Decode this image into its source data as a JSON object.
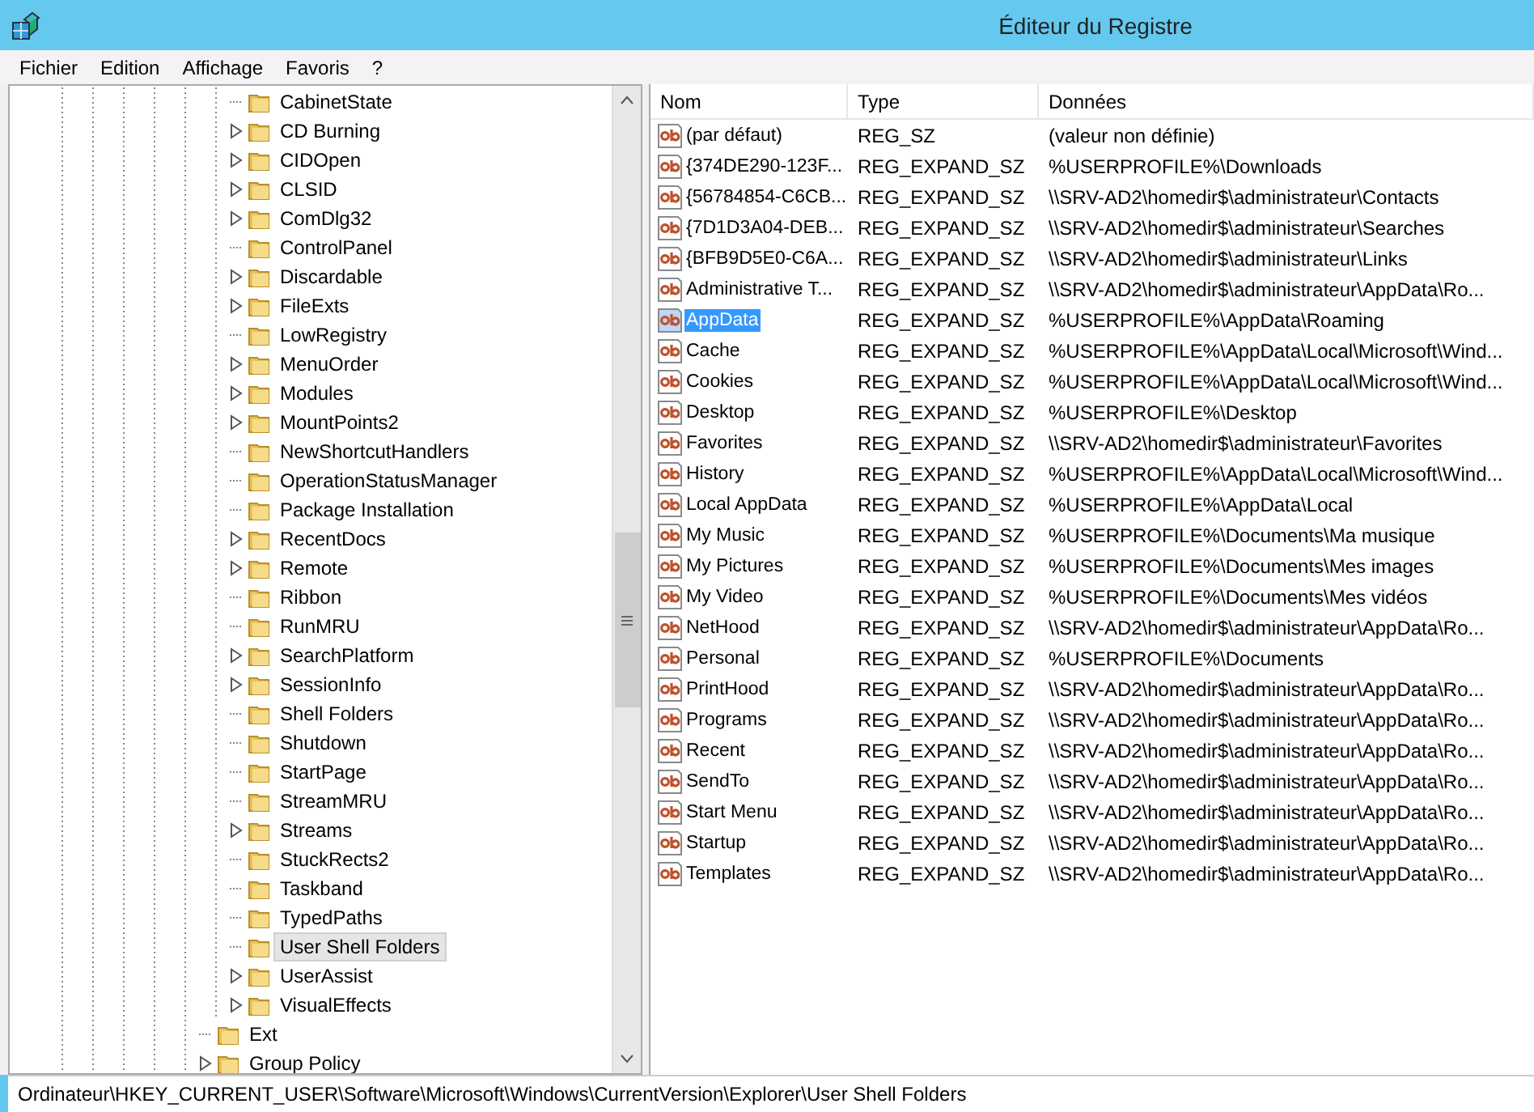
{
  "window": {
    "title": "Éditeur du Registre"
  },
  "menu": [
    "Fichier",
    "Edition",
    "Affichage",
    "Favoris",
    "?"
  ],
  "tree": {
    "nodes": [
      {
        "children": [
          {
            "label": "CabinetState",
            "expandable": false,
            "selected": false
          },
          {
            "label": "CD Burning",
            "expandable": true,
            "selected": false
          },
          {
            "label": "CIDOpen",
            "expandable": true,
            "selected": false
          },
          {
            "label": "CLSID",
            "expandable": true,
            "selected": false
          },
          {
            "label": "ComDlg32",
            "expandable": true,
            "selected": false
          },
          {
            "label": "ControlPanel",
            "expandable": false,
            "selected": false
          },
          {
            "label": "Discardable",
            "expandable": true,
            "selected": false
          },
          {
            "label": "FileExts",
            "expandable": true,
            "selected": false
          },
          {
            "label": "LowRegistry",
            "expandable": false,
            "selected": false
          },
          {
            "label": "MenuOrder",
            "expandable": true,
            "selected": false
          },
          {
            "label": "Modules",
            "expandable": true,
            "selected": false
          },
          {
            "label": "MountPoints2",
            "expandable": true,
            "selected": false
          },
          {
            "label": "NewShortcutHandlers",
            "expandable": false,
            "selected": false
          },
          {
            "label": "OperationStatusManager",
            "expandable": false,
            "selected": false
          },
          {
            "label": "Package Installation",
            "expandable": false,
            "selected": false
          },
          {
            "label": "RecentDocs",
            "expandable": true,
            "selected": false
          },
          {
            "label": "Remote",
            "expandable": true,
            "selected": false
          },
          {
            "label": "Ribbon",
            "expandable": false,
            "selected": false
          },
          {
            "label": "RunMRU",
            "expandable": false,
            "selected": false
          },
          {
            "label": "SearchPlatform",
            "expandable": true,
            "selected": false
          },
          {
            "label": "SessionInfo",
            "expandable": true,
            "selected": false
          },
          {
            "label": "Shell Folders",
            "expandable": false,
            "selected": false
          },
          {
            "label": "Shutdown",
            "expandable": false,
            "selected": false
          },
          {
            "label": "StartPage",
            "expandable": false,
            "selected": false
          },
          {
            "label": "StreamMRU",
            "expandable": false,
            "selected": false
          },
          {
            "label": "Streams",
            "expandable": true,
            "selected": false
          },
          {
            "label": "StuckRects2",
            "expandable": false,
            "selected": false
          },
          {
            "label": "Taskband",
            "expandable": false,
            "selected": false
          },
          {
            "label": "TypedPaths",
            "expandable": false,
            "selected": false
          },
          {
            "label": "User Shell Folders",
            "expandable": false,
            "selected": true
          },
          {
            "label": "UserAssist",
            "expandable": true,
            "selected": false
          },
          {
            "label": "VisualEffects",
            "expandable": true,
            "selected": false
          }
        ]
      },
      {
        "label": "Ext",
        "expandable": false,
        "selected": false
      },
      {
        "label": "Group Policy",
        "expandable": true,
        "selected": false
      }
    ]
  },
  "table": {
    "columns": [
      "Nom",
      "Type",
      "Données"
    ],
    "rows": [
      {
        "name": "(par défaut)",
        "type": "REG_SZ",
        "data": "(valeur non définie)",
        "selected": false
      },
      {
        "name": "{374DE290-123F...",
        "type": "REG_EXPAND_SZ",
        "data": "%USERPROFILE%\\Downloads",
        "selected": false
      },
      {
        "name": "{56784854-C6CB...",
        "type": "REG_EXPAND_SZ",
        "data": "\\\\SRV-AD2\\homedir$\\administrateur\\Contacts",
        "selected": false
      },
      {
        "name": "{7D1D3A04-DEB...",
        "type": "REG_EXPAND_SZ",
        "data": "\\\\SRV-AD2\\homedir$\\administrateur\\Searches",
        "selected": false
      },
      {
        "name": "{BFB9D5E0-C6A...",
        "type": "REG_EXPAND_SZ",
        "data": "\\\\SRV-AD2\\homedir$\\administrateur\\Links",
        "selected": false
      },
      {
        "name": "Administrative T...",
        "type": "REG_EXPAND_SZ",
        "data": "\\\\SRV-AD2\\homedir$\\administrateur\\AppData\\Ro...",
        "selected": false
      },
      {
        "name": "AppData",
        "type": "REG_EXPAND_SZ",
        "data": "%USERPROFILE%\\AppData\\Roaming",
        "selected": true
      },
      {
        "name": "Cache",
        "type": "REG_EXPAND_SZ",
        "data": "%USERPROFILE%\\AppData\\Local\\Microsoft\\Wind...",
        "selected": false
      },
      {
        "name": "Cookies",
        "type": "REG_EXPAND_SZ",
        "data": "%USERPROFILE%\\AppData\\Local\\Microsoft\\Wind...",
        "selected": false
      },
      {
        "name": "Desktop",
        "type": "REG_EXPAND_SZ",
        "data": "%USERPROFILE%\\Desktop",
        "selected": false
      },
      {
        "name": "Favorites",
        "type": "REG_EXPAND_SZ",
        "data": "\\\\SRV-AD2\\homedir$\\administrateur\\Favorites",
        "selected": false
      },
      {
        "name": "History",
        "type": "REG_EXPAND_SZ",
        "data": "%USERPROFILE%\\AppData\\Local\\Microsoft\\Wind...",
        "selected": false
      },
      {
        "name": "Local AppData",
        "type": "REG_EXPAND_SZ",
        "data": "%USERPROFILE%\\AppData\\Local",
        "selected": false
      },
      {
        "name": "My Music",
        "type": "REG_EXPAND_SZ",
        "data": "%USERPROFILE%\\Documents\\Ma musique",
        "selected": false
      },
      {
        "name": "My Pictures",
        "type": "REG_EXPAND_SZ",
        "data": "%USERPROFILE%\\Documents\\Mes images",
        "selected": false
      },
      {
        "name": "My Video",
        "type": "REG_EXPAND_SZ",
        "data": "%USERPROFILE%\\Documents\\Mes vidéos",
        "selected": false
      },
      {
        "name": "NetHood",
        "type": "REG_EXPAND_SZ",
        "data": "\\\\SRV-AD2\\homedir$\\administrateur\\AppData\\Ro...",
        "selected": false
      },
      {
        "name": "Personal",
        "type": "REG_EXPAND_SZ",
        "data": "%USERPROFILE%\\Documents",
        "selected": false
      },
      {
        "name": "PrintHood",
        "type": "REG_EXPAND_SZ",
        "data": "\\\\SRV-AD2\\homedir$\\administrateur\\AppData\\Ro...",
        "selected": false
      },
      {
        "name": "Programs",
        "type": "REG_EXPAND_SZ",
        "data": "\\\\SRV-AD2\\homedir$\\administrateur\\AppData\\Ro...",
        "selected": false
      },
      {
        "name": "Recent",
        "type": "REG_EXPAND_SZ",
        "data": "\\\\SRV-AD2\\homedir$\\administrateur\\AppData\\Ro...",
        "selected": false
      },
      {
        "name": "SendTo",
        "type": "REG_EXPAND_SZ",
        "data": "\\\\SRV-AD2\\homedir$\\administrateur\\AppData\\Ro...",
        "selected": false
      },
      {
        "name": "Start Menu",
        "type": "REG_EXPAND_SZ",
        "data": "\\\\SRV-AD2\\homedir$\\administrateur\\AppData\\Ro...",
        "selected": false
      },
      {
        "name": "Startup",
        "type": "REG_EXPAND_SZ",
        "data": "\\\\SRV-AD2\\homedir$\\administrateur\\AppData\\Ro...",
        "selected": false
      },
      {
        "name": "Templates",
        "type": "REG_EXPAND_SZ",
        "data": "\\\\SRV-AD2\\homedir$\\administrateur\\AppData\\Ro...",
        "selected": false
      }
    ]
  },
  "status_bar": "Ordinateur\\HKEY_CURRENT_USER\\Software\\Microsoft\\Windows\\CurrentVersion\\Explorer\\User Shell Folders"
}
